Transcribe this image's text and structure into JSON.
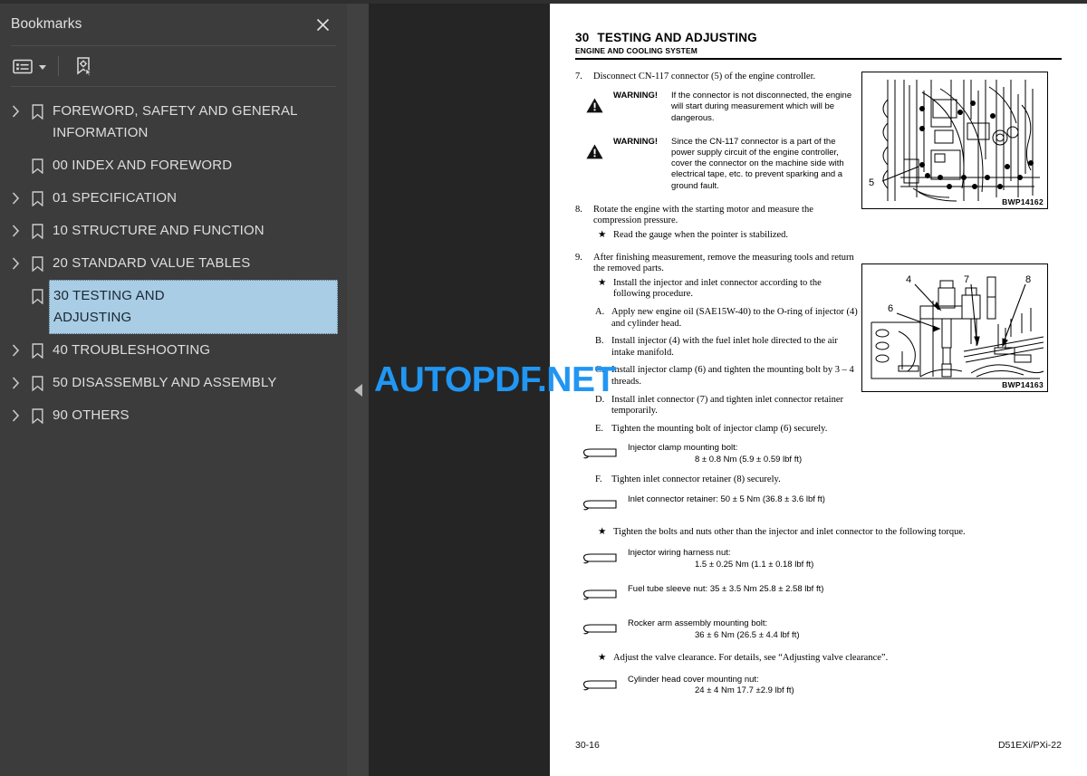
{
  "sidebar": {
    "title": "Bookmarks",
    "close_icon": "close-icon",
    "toolbar": {
      "options_icon": "list-options-icon",
      "new_bookmark_icon": "new-bookmark-icon"
    },
    "items": [
      {
        "label": "FOREWORD, SAFETY AND GENERAL\nINFORMATION",
        "expandable": true,
        "selected": false
      },
      {
        "label": "00 INDEX AND FOREWORD",
        "expandable": false,
        "selected": false
      },
      {
        "label": "01 SPECIFICATION",
        "expandable": true,
        "selected": false
      },
      {
        "label": "10 STRUCTURE AND FUNCTION",
        "expandable": true,
        "selected": false
      },
      {
        "label": "20 STANDARD VALUE TABLES",
        "expandable": true,
        "selected": false
      },
      {
        "label": "30 TESTING AND ADJUSTING",
        "expandable": false,
        "selected": true
      },
      {
        "label": "40 TROUBLESHOOTING",
        "expandable": true,
        "selected": false
      },
      {
        "label": "50 DISASSEMBLY AND ASSEMBLY",
        "expandable": true,
        "selected": false
      },
      {
        "label": "90 OTHERS",
        "expandable": true,
        "selected": false
      }
    ]
  },
  "rail": {
    "collapse_icon": "collapse-left-triangle-icon"
  },
  "watermark": {
    "text": "AUTOPDF.NET",
    "color": "#2196f3"
  },
  "page": {
    "header": {
      "number": "30",
      "title": "TESTING AND ADJUSTING",
      "subtitle": "ENGINE AND COOLING SYSTEM"
    },
    "step7": {
      "num": "7.",
      "text": "Disconnect CN-117 connector (5) of the engine controller."
    },
    "warnings": [
      {
        "label": "WARNING!",
        "text": "If the connector is not disconnected, the engine will start during measurement which will be dangerous."
      },
      {
        "label": "WARNING!",
        "text": "Since the CN-117 connector is a part of the power supply circuit of the engine controller, cover the connector on the machine side with electrical tape, etc. to prevent sparking and a ground fault."
      }
    ],
    "step8": {
      "num": "8.",
      "text": "Rotate the engine with the starting motor and measure the compression pressure.",
      "note": "Read the gauge when the pointer is stabilized."
    },
    "step9": {
      "num": "9.",
      "text": "After finishing measurement, remove the measuring tools and return the removed parts.",
      "note": "Install the injector and inlet connector according to the following procedure.",
      "items": [
        {
          "letter": "A.",
          "text": "Apply new engine oil (SAE15W-40) to the O-ring of injector (4) and cylinder head."
        },
        {
          "letter": "B.",
          "text": "Install injector (4) with the fuel inlet hole directed to the air intake manifold."
        },
        {
          "letter": "C.",
          "text": "Install injector clamp (6) and tighten the mounting bolt by 3 – 4 threads."
        },
        {
          "letter": "D.",
          "text": "Install inlet connector (7) and tighten inlet connector retainer temporarily."
        },
        {
          "letter": "E.",
          "text": "Tighten the mounting bolt of injector clamp (6) securely."
        }
      ],
      "item_f": {
        "letter": "F.",
        "text": "Tighten inlet connector retainer (8) securely."
      }
    },
    "torque_specs": [
      {
        "name": "Injector clamp mounting bolt:",
        "value": "8 ± 0.8 Nm (5.9 ± 0.59 lbf ft)",
        "inline": false
      },
      {
        "name": "Inlet connector retainer: 50 ± 5 Nm (36.8 ± 3.6 lbf ft)",
        "value": "",
        "inline": true
      },
      {
        "name": "Injector wiring harness nut:",
        "value": "1.5 ± 0.25 Nm (1.1 ± 0.18 lbf ft)",
        "inline": false
      },
      {
        "name": "Fuel tube sleeve nut: 35 ± 3.5 Nm 25.8 ± 2.58 lbf ft)",
        "value": "",
        "inline": true
      },
      {
        "name": "Rocker arm assembly mounting bolt:",
        "value": "36 ± 6 Nm (26.5 ± 4.4 lbf ft)",
        "inline": false
      },
      {
        "name": "Cylinder head cover mounting nut:",
        "value": "24 ± 4 Nm 17.7 ±2.9 lbf ft)",
        "inline": false
      }
    ],
    "note_torque": "Tighten the bolts and nuts other than the injector and inlet connector to the following torque.",
    "note_valve": "Adjust the valve clearance. For details, see “Adjusting valve clearance”.",
    "figures": [
      {
        "caption": "BWP14162",
        "callouts": [
          "5"
        ]
      },
      {
        "caption": "BWP14163",
        "callouts": [
          "4",
          "7",
          "8",
          "6"
        ]
      }
    ],
    "footer": {
      "page_number": "30-16",
      "model": "D51EXi/PXi-22"
    }
  }
}
